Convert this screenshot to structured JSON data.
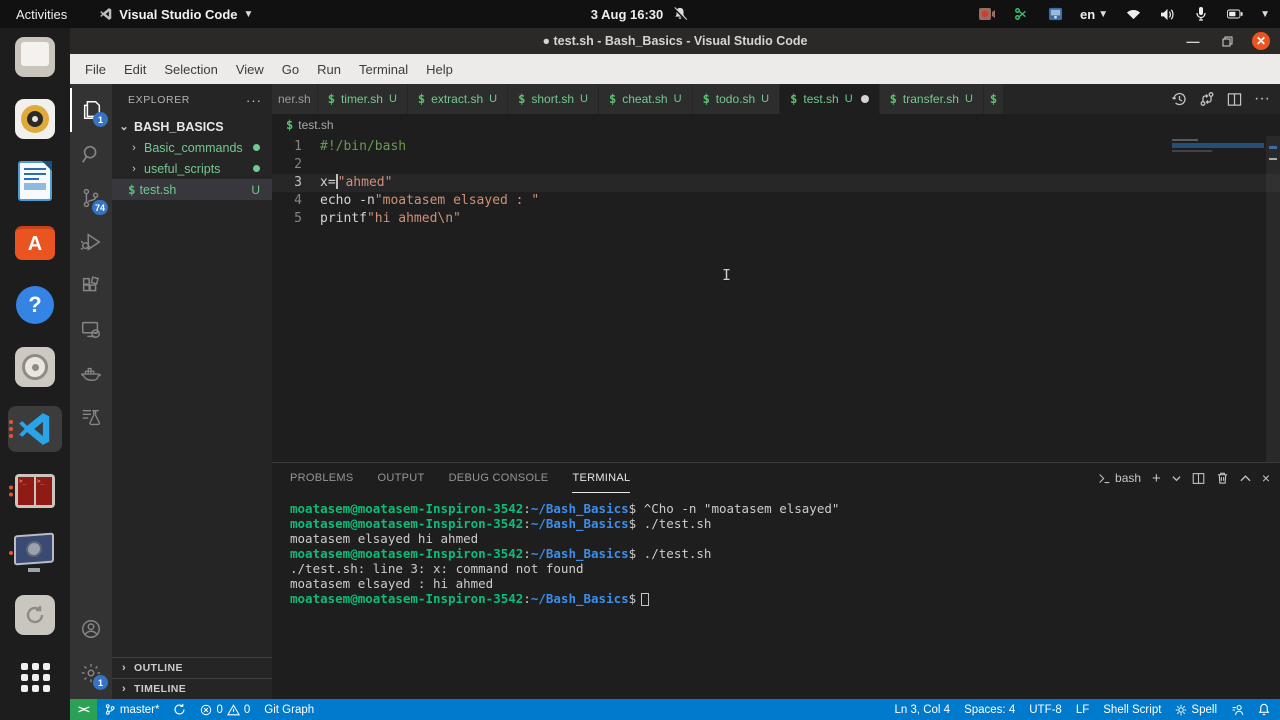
{
  "topbar": {
    "activities_label": "Activities",
    "app_menu_label": "Visual Studio Code",
    "clock": "3 Aug 16:30",
    "keyboard_layout": "en"
  },
  "dock": {
    "items": [
      {
        "name": "files-app",
        "running": 0
      },
      {
        "name": "rhythmbox",
        "running": 0
      },
      {
        "name": "libreoffice-writer",
        "running": 0
      },
      {
        "name": "ubuntu-software",
        "running": 0
      },
      {
        "name": "help",
        "running": 0
      },
      {
        "name": "disks",
        "running": 0
      },
      {
        "name": "vscode",
        "running": 3,
        "active": true
      },
      {
        "name": "terminal-app",
        "running": 2
      },
      {
        "name": "media-player",
        "running": 1
      },
      {
        "name": "backups",
        "running": 0
      },
      {
        "name": "show-apps",
        "running": 0
      }
    ]
  },
  "window": {
    "title": "● test.sh - Bash_Basics - Visual Studio Code",
    "menus": [
      "File",
      "Edit",
      "Selection",
      "View",
      "Go",
      "Run",
      "Terminal",
      "Help"
    ]
  },
  "activity_bar": {
    "explorer_badge": "1",
    "scm_badge": "74",
    "settings_badge": "1"
  },
  "explorer": {
    "header": "EXPLORER",
    "more_actions": "···",
    "root": "BASH_BASICS",
    "items": [
      {
        "label": "Basic_commands",
        "type": "folder",
        "modified_dot": true
      },
      {
        "label": "useful_scripts",
        "type": "folder",
        "modified_dot": true
      },
      {
        "label": "test.sh",
        "type": "file",
        "badge": "U",
        "selected": true
      }
    ],
    "outline_label": "OUTLINE",
    "timeline_label": "TIMELINE"
  },
  "tab_bar": {
    "tabs": [
      {
        "label": "ner.sh",
        "partial": true,
        "icon": false,
        "muted": true
      },
      {
        "label": "timer.sh",
        "badge": "U",
        "icon": true
      },
      {
        "label": "extract.sh",
        "badge": "U",
        "icon": true
      },
      {
        "label": "short.sh",
        "badge": "U",
        "icon": true
      },
      {
        "label": "cheat.sh",
        "badge": "U",
        "icon": true
      },
      {
        "label": "todo.sh",
        "badge": "U",
        "icon": true
      },
      {
        "label": "test.sh",
        "badge": "U",
        "icon": true,
        "active": true,
        "dirty": true
      },
      {
        "label": "transfer.sh",
        "badge": "U",
        "icon": true
      },
      {
        "label": "",
        "partial": true,
        "icon": true
      }
    ]
  },
  "editor": {
    "breadcrumb": "test.sh",
    "lines": [
      {
        "num": "1",
        "tokens": [
          [
            "comment",
            "#!/bin/bash"
          ]
        ]
      },
      {
        "num": "2",
        "tokens": []
      },
      {
        "num": "3",
        "current": true,
        "tokens": [
          [
            "plain",
            "x= "
          ],
          [
            "cursor",
            ""
          ],
          [
            "string",
            "\"ahmed\""
          ]
        ]
      },
      {
        "num": "4",
        "tokens": [
          [
            "plain",
            "echo -n "
          ],
          [
            "string",
            "\"moatasem elsayed : \""
          ]
        ]
      },
      {
        "num": "5",
        "tokens": [
          [
            "plain",
            "printf "
          ],
          [
            "string",
            "\"hi ahmed\\n\""
          ]
        ]
      }
    ]
  },
  "panel": {
    "tabs": [
      {
        "label": "PROBLEMS"
      },
      {
        "label": "OUTPUT"
      },
      {
        "label": "DEBUG CONSOLE"
      },
      {
        "label": "TERMINAL",
        "active": true
      }
    ],
    "shell_label": "bash",
    "terminal": {
      "prompt_user": "moatasem@moatasem-Inspiron-3542",
      "prompt_path": "~/Bash_Basics",
      "lines": [
        {
          "prompt": true,
          "command": " ^Cho -n \"moatasem elsayed\""
        },
        {
          "prompt": true,
          "command": " ./test.sh"
        },
        {
          "text": "moatasem elsayed hi ahmed"
        },
        {
          "prompt": true,
          "command": " ./test.sh"
        },
        {
          "text": "./test.sh: line 3: x: command not found"
        },
        {
          "text": "moatasem elsayed : hi ahmed"
        },
        {
          "prompt": true,
          "command": "",
          "cursor": true
        }
      ]
    }
  },
  "status_bar": {
    "remote_label": "><",
    "branch": "master*",
    "errors": "0",
    "warnings": "0",
    "git_graph": "Git Graph",
    "line_col": "Ln 3, Col 4",
    "spaces": "Spaces: 4",
    "encoding": "UTF-8",
    "eol": "LF",
    "language": "Shell Script",
    "spell": "Spell"
  }
}
